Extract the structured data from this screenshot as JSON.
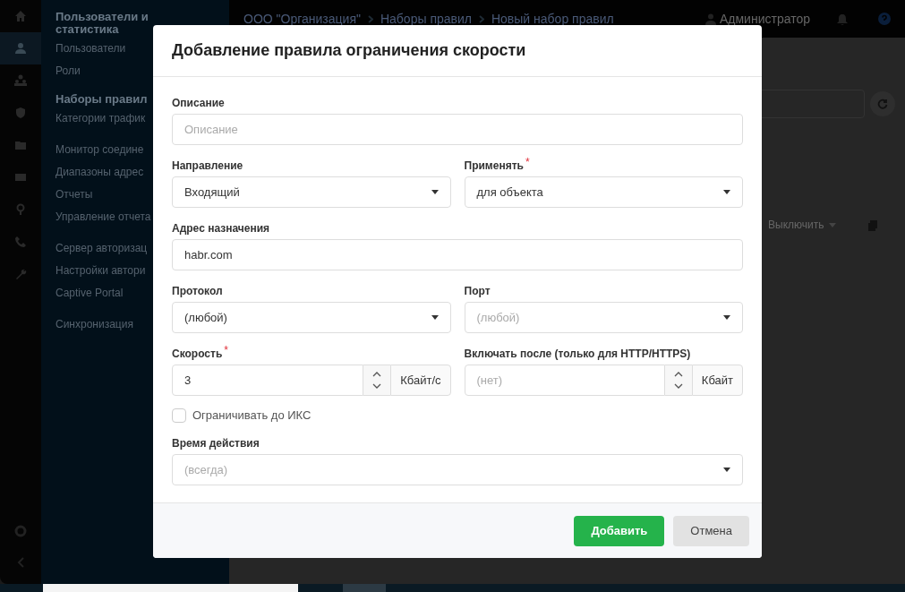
{
  "topbar": {
    "breadcrumbs": [
      "ООО \"Организация\"",
      "Наборы правил",
      "Новый набор правил"
    ],
    "user": "Администратор"
  },
  "sidebar": {
    "groups": [
      {
        "title": "Пользователи и статистика",
        "items": [
          "Пользователи",
          "Роли"
        ]
      },
      {
        "title": "Наборы правил",
        "items": [
          "Категории трафик"
        ]
      },
      {
        "items": [
          "Монитор соедине",
          "Диапазоны адрес",
          "Отчеты",
          "Управление отчета"
        ]
      },
      {
        "items": [
          "Сервер авторизац",
          "Настройки автори",
          "Captive Portal"
        ]
      },
      {
        "items": [
          "Синхронизация"
        ]
      }
    ]
  },
  "rail": {
    "icons": [
      {
        "kind": "home",
        "selected": false
      },
      {
        "kind": "user",
        "selected": true
      },
      {
        "kind": "users",
        "selected": false
      },
      {
        "kind": "shield",
        "selected": false
      },
      {
        "kind": "folder",
        "selected": false
      },
      {
        "kind": "mail",
        "selected": false
      },
      {
        "kind": "pin",
        "selected": false
      },
      {
        "kind": "phone",
        "selected": false
      },
      {
        "kind": "wrench",
        "selected": false
      }
    ]
  },
  "background": {
    "button": "Выключить"
  },
  "modal": {
    "title": "Добавление правила ограничения скорости",
    "rows": [
      [
        {
          "kind": "text",
          "label": "Описание",
          "placeholder": "Описание"
        }
      ],
      [
        {
          "kind": "select",
          "label": "Направление",
          "value": "Входящий"
        },
        {
          "kind": "select",
          "label": "Применять",
          "required_mark": "*",
          "value": "для объекта"
        }
      ],
      [
        {
          "kind": "text",
          "label": "Адрес назначения",
          "value": "habr.com"
        }
      ],
      [
        {
          "kind": "select",
          "label": "Протокол",
          "value": "(любой)"
        },
        {
          "kind": "select",
          "label": "Порт",
          "placeholder": "(любой)"
        }
      ],
      [
        {
          "kind": "spinner",
          "label": "Скорость",
          "required_mark": "*",
          "value": "3",
          "unit": "Кбайт/с"
        },
        {
          "kind": "spinner",
          "label": "Включать после (только для HTTP/HTTPS)",
          "placeholder": "(нет)",
          "unit": "Кбайт"
        }
      ],
      [
        {
          "kind": "checkbox",
          "label": "Ограничивать до ИКС",
          "checked": false
        }
      ],
      [
        {
          "kind": "select",
          "label": "Время действия",
          "placeholder": "(всегда)"
        }
      ]
    ],
    "buttons": [
      {
        "label": "Добавить",
        "kind": "primary"
      },
      {
        "label": "Отмена",
        "kind": "secondary"
      }
    ]
  }
}
